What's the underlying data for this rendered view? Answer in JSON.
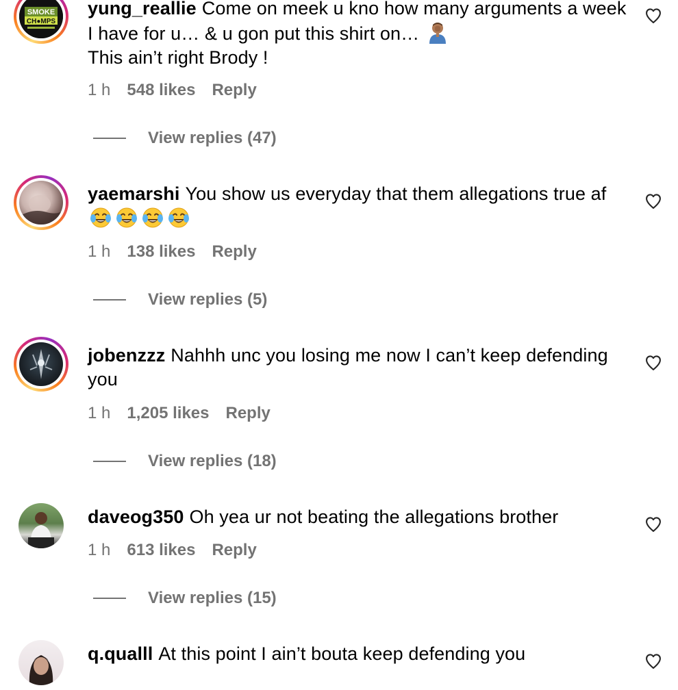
{
  "comments": [
    {
      "username": "yung_reallie",
      "text": "Come on meek u kno how many arguments a week I have for u… & u gon put this shirt on…",
      "text_line2": "This ain’t right Brody !",
      "time": "1 h",
      "likes": "548 likes",
      "reply": "Reply",
      "view_replies": "View replies (47)",
      "avatar_logo_line1": "SMOKE",
      "avatar_logo_line2": "CH●MPS",
      "emoji": "facepalm-emoji"
    },
    {
      "username": "yaemarshi",
      "text": "You show us everyday that them allegations true af",
      "time": "1 h",
      "likes": "138 likes",
      "reply": "Reply",
      "view_replies": "View replies (5)",
      "emoji": "laughing-crying-emoji"
    },
    {
      "username": "jobenzzz",
      "text": "Nahhh unc you losing me now I can’t keep defending you",
      "time": "1 h",
      "likes": "1,205 likes",
      "reply": "Reply",
      "view_replies": "View replies (18)"
    },
    {
      "username": "daveog350",
      "text": "Oh yea ur not beating the allegations brother",
      "time": "1 h",
      "likes": "613 likes",
      "reply": "Reply",
      "view_replies": "View replies (15)"
    },
    {
      "username": "q.qualll",
      "text": "At this point I ain’t bouta keep defending you"
    }
  ],
  "icons": {
    "like": "heart-outline-icon"
  },
  "colors": {
    "text": "#000000",
    "secondary": "#737373",
    "story_ring_start": "#feda75",
    "story_ring_end": "#962fbf"
  }
}
